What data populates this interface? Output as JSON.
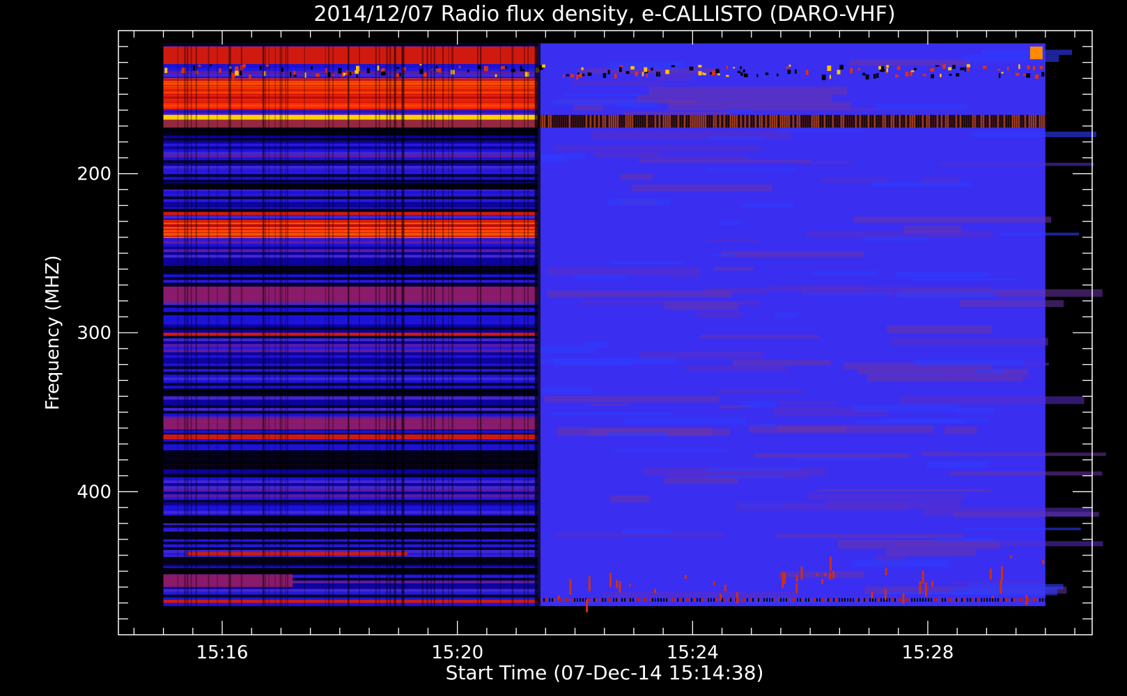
{
  "chart_data": {
    "type": "heatmap",
    "title": "2014/12/07  Radio flux density, e-CALLISTO (DARO-VHF)",
    "xlabel": "Start Time (07-Dec-14 15:14:38)",
    "ylabel": "Frequency (MHZ)",
    "x_ticks": [
      "15:16",
      "15:20",
      "15:24",
      "15:28"
    ],
    "x_tick_minutes": [
      16,
      20,
      24,
      28
    ],
    "x_data_range": [
      "15:15:00",
      "15:30:00"
    ],
    "y_ticks": [
      200,
      300,
      400
    ],
    "y_range_mhz": [
      110,
      490
    ],
    "y_data_range_mhz": [
      118,
      472
    ],
    "y_axis_inverted": true,
    "colormap": [
      "#000000",
      "#1a00cc",
      "#3030ff",
      "#7a1a9a",
      "#c81a10",
      "#ff4a00",
      "#ffd000"
    ],
    "event": {
      "description_time": "15:21:22",
      "note": "sharp background level change at ~15:21:20"
    },
    "bands_before_mhz": [
      {
        "from": 120,
        "to": 131,
        "level": "red"
      },
      {
        "from": 140,
        "to": 160,
        "level": "red-bright"
      },
      {
        "from": 163,
        "to": 166,
        "level": "yellow"
      },
      {
        "from": 224,
        "to": 226,
        "level": "red"
      },
      {
        "from": 229,
        "to": 240,
        "level": "red-bright"
      },
      {
        "from": 271,
        "to": 281,
        "level": "red-dim"
      },
      {
        "from": 300,
        "to": 302,
        "level": "red"
      },
      {
        "from": 354,
        "to": 361,
        "level": "red-dim"
      },
      {
        "from": 364,
        "to": 367,
        "level": "red"
      },
      {
        "from": 438,
        "to": 440,
        "level": "red"
      },
      {
        "from": 452,
        "to": 460,
        "level": "red-dim"
      },
      {
        "from": 468,
        "to": 470,
        "level": "red"
      }
    ],
    "grid": false
  }
}
